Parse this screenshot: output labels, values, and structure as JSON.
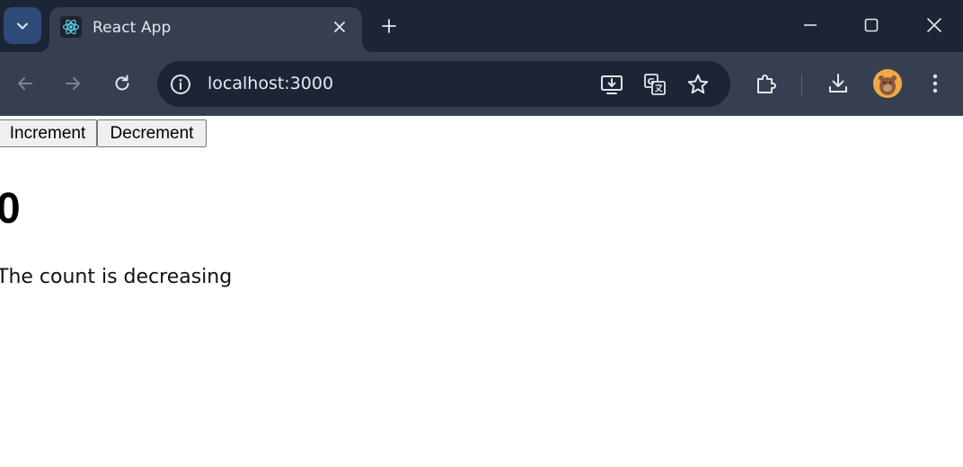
{
  "browser": {
    "tab": {
      "title": "React App",
      "favicon": "react-logo-icon"
    },
    "address_bar": {
      "url": "localhost:3000"
    },
    "colors": {
      "tabstrip": "#1c2535",
      "toolbar": "#363f4f",
      "omnibox": "#1c2535",
      "accent": "#2e4a78"
    }
  },
  "page": {
    "buttons": {
      "increment_label": "Increment",
      "decrement_label": "Decrement"
    },
    "count": "0",
    "status_text": "The count is decreasing"
  }
}
